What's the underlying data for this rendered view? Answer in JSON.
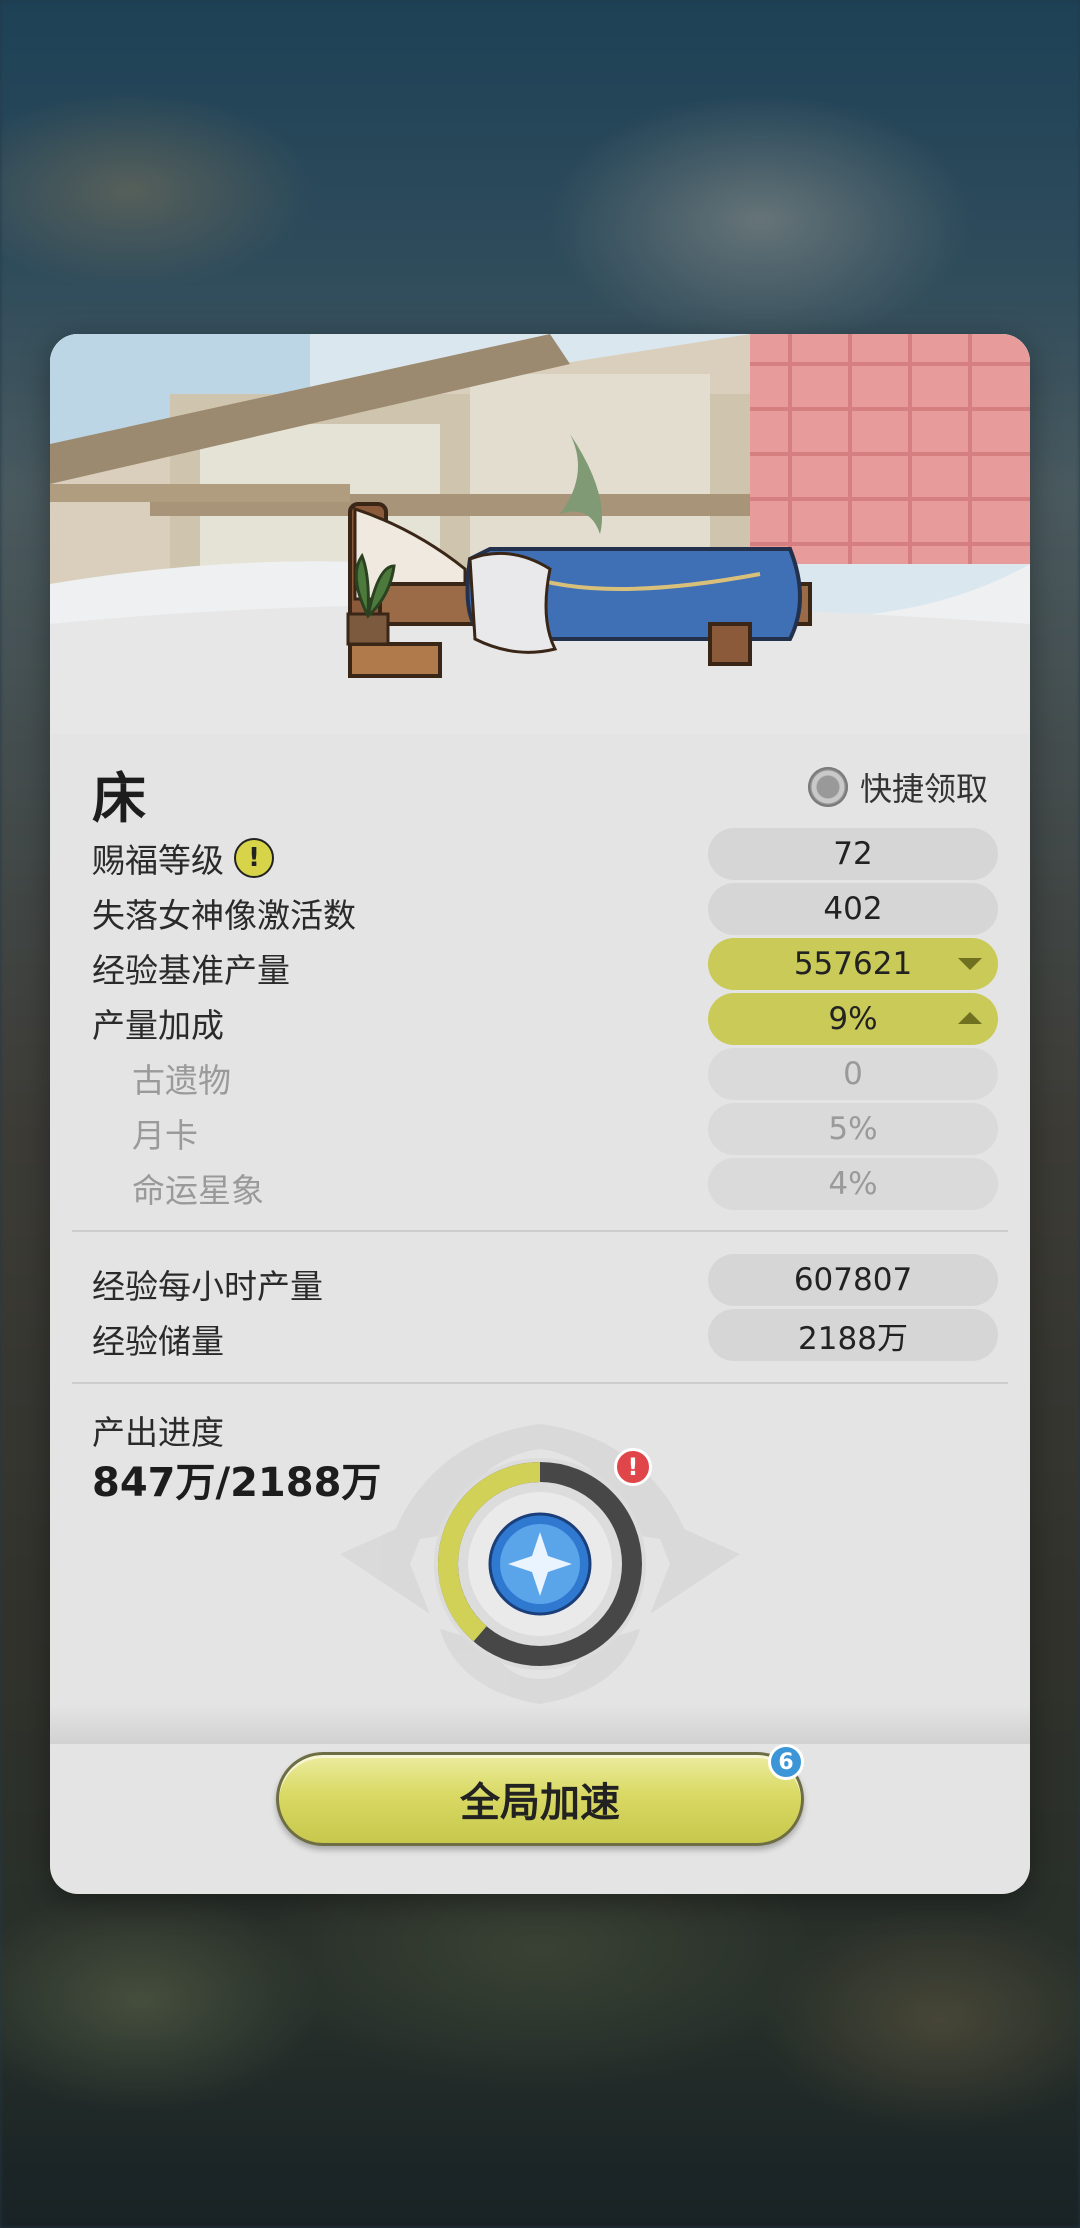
{
  "item": {
    "title": "床",
    "quick_claim_label": "快捷领取",
    "quick_claim_checked": false
  },
  "stats": [
    {
      "label": "赐福等级",
      "value": "72",
      "has_info_icon": true
    },
    {
      "label": "失落女神像激活数",
      "value": "402"
    },
    {
      "label": "经验基准产量",
      "value": "557621",
      "highlight": true,
      "arrow": "down"
    },
    {
      "label": "产量加成",
      "value": "9%",
      "highlight": true,
      "arrow": "up"
    }
  ],
  "bonus_breakdown": [
    {
      "label": "古遗物",
      "value": "0"
    },
    {
      "label": "月卡",
      "value": "5%"
    },
    {
      "label": "命运星象",
      "value": "4%"
    }
  ],
  "output": [
    {
      "label": "经验每小时产量",
      "value": "607807"
    },
    {
      "label": "经验储量",
      "value": "2188万"
    }
  ],
  "progress": {
    "label": "产出进度",
    "value_text": "847万/2188万",
    "fraction": 0.387,
    "alert_glyph": "!"
  },
  "boost": {
    "label": "全局加速",
    "badge_count": "6"
  },
  "colors": {
    "accent": "#c9ca58",
    "alert": "#e0454a",
    "badge": "#3b95d6"
  }
}
